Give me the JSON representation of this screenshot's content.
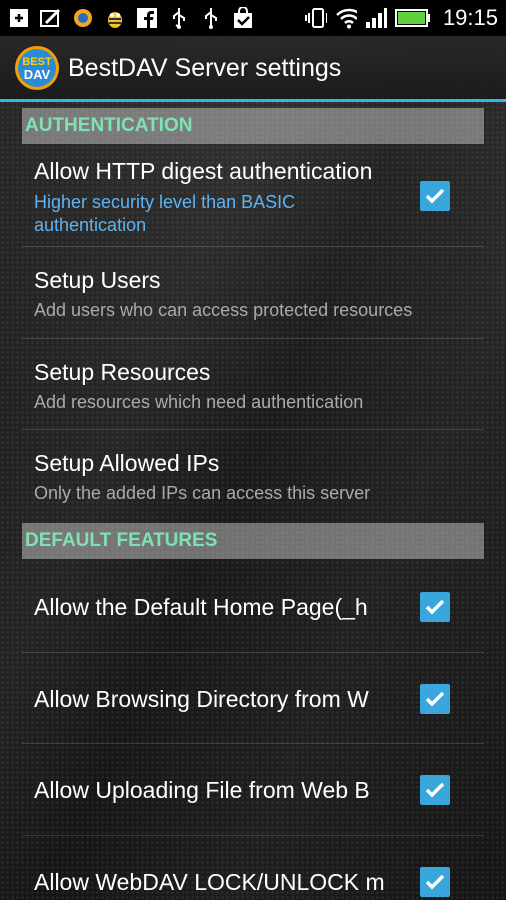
{
  "status_bar": {
    "time": "19:15",
    "icons": [
      "plus-box-icon",
      "edit-icon",
      "app-icon",
      "bee-icon",
      "facebook-icon",
      "usb-icon",
      "usb-icon",
      "shopping-bag-icon",
      "vibrate-icon",
      "wifi-icon",
      "signal-icon",
      "battery-icon"
    ]
  },
  "action_bar": {
    "title": "BestDAV Server settings",
    "logo_text_top": "BEST",
    "logo_text_bottom": "DAV"
  },
  "sections": {
    "authentication": "AUTHENTICATION",
    "default_features": "DEFAULT FEATURES"
  },
  "prefs": {
    "digest": {
      "title": "Allow HTTP digest authentication",
      "summary": "Higher security level than BASIC authentication",
      "checked": true
    },
    "users": {
      "title": "Setup Users",
      "summary": "Add users who can access protected resources"
    },
    "resources": {
      "title": "Setup Resources",
      "summary": "Add resources which need authentication"
    },
    "ips": {
      "title": "Setup Allowed IPs",
      "summary": "Only the added IPs can access this server"
    },
    "home_page": {
      "title": "Allow the Default Home Page(_h",
      "checked": true
    },
    "browsing": {
      "title": "Allow Browsing Directory from W",
      "checked": true
    },
    "uploading": {
      "title": "Allow Uploading File from Web B",
      "checked": true
    },
    "lock": {
      "title": "Allow WebDAV LOCK/UNLOCK m",
      "checked": true
    }
  },
  "colors": {
    "accent": "#33b5e5",
    "section_text": "#7ee3b3",
    "summary_blue": "#5fb3f0",
    "checkbox": "#39a6dc"
  }
}
